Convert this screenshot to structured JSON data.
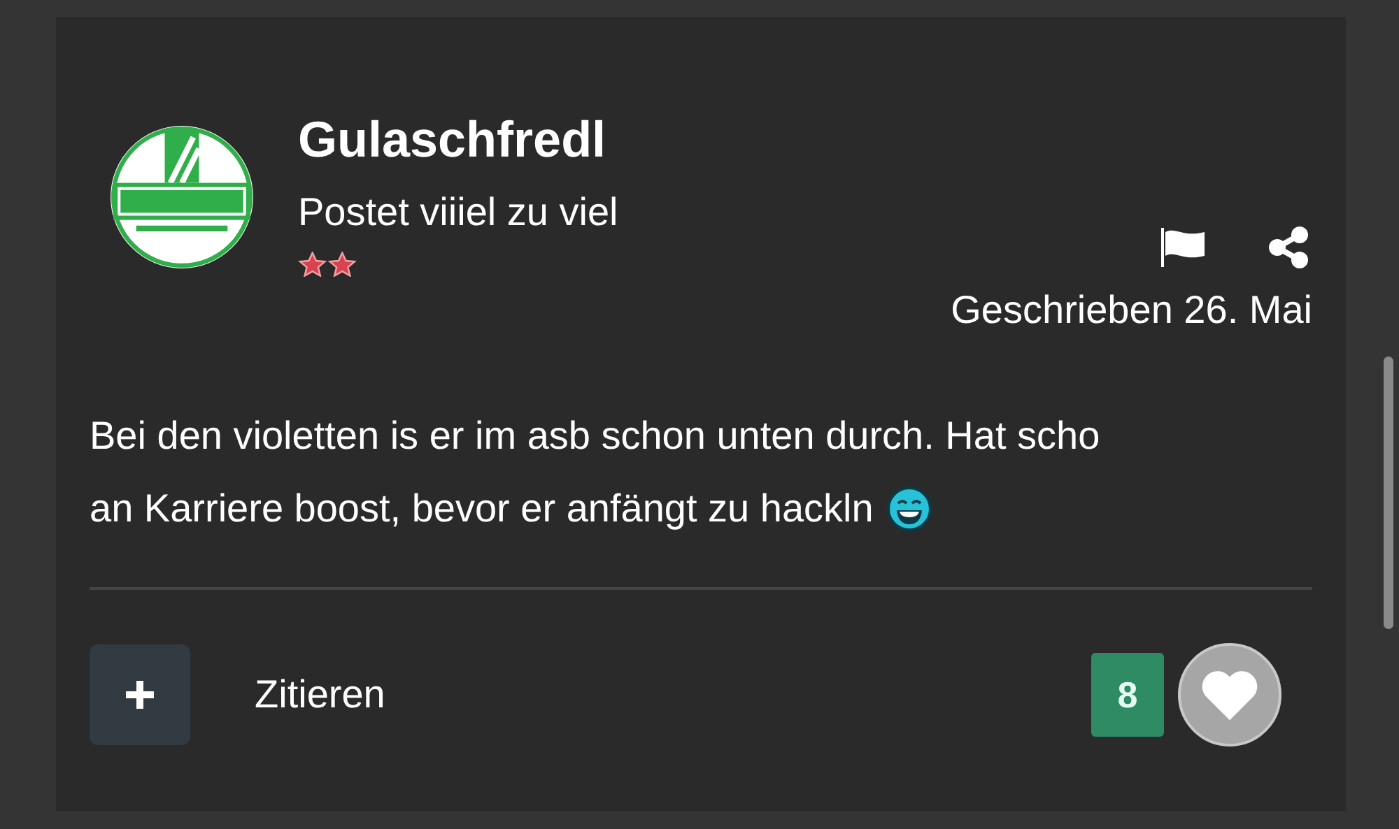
{
  "post": {
    "author": "Gulaschfredl",
    "rank": "Postet viiiel zu viel",
    "date": "Geschrieben 26. Mai",
    "body": [
      "Bei den violetten is er im asb schon unten durch. Hat scho",
      "an Karriere boost, bevor er anfängt zu hackln"
    ],
    "quote_label": "Zitieren",
    "like_count": "8"
  }
}
